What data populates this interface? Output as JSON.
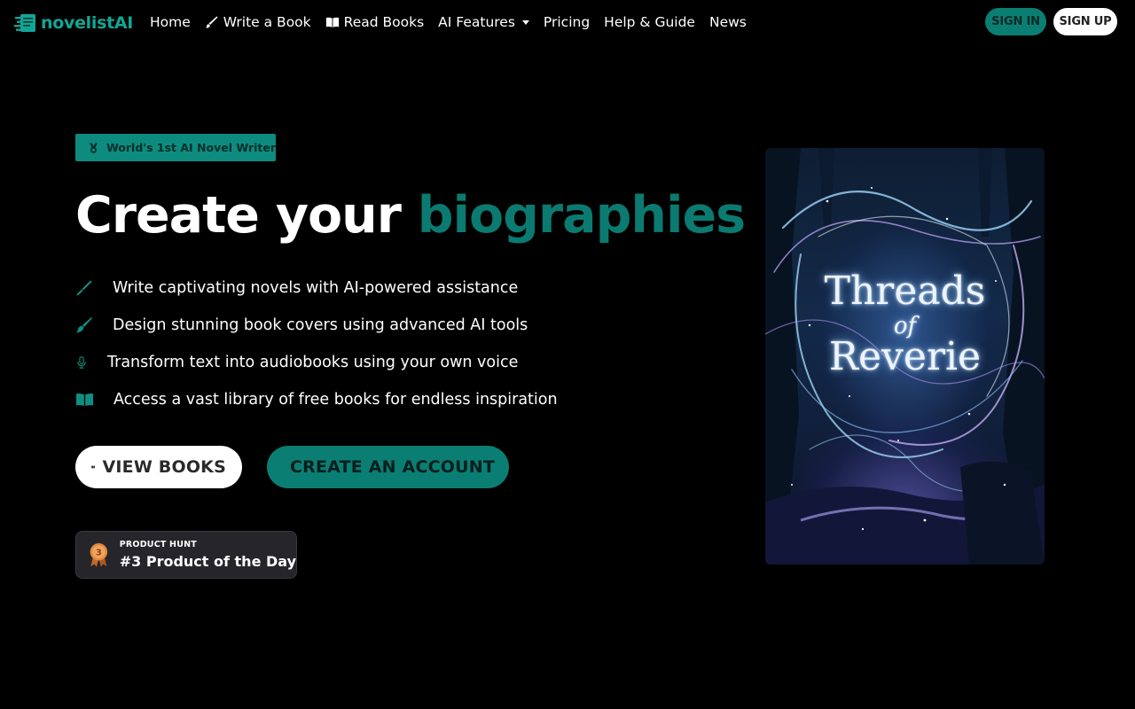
{
  "brand": {
    "name": "novelistAI"
  },
  "nav": {
    "links": [
      {
        "label": "Home",
        "icon": ""
      },
      {
        "label": "Write a Book",
        "icon": "pencil-icon"
      },
      {
        "label": "Read Books",
        "icon": "book-open-icon"
      },
      {
        "label": "AI Features",
        "icon": "chevron-down-icon"
      },
      {
        "label": "Pricing",
        "icon": ""
      },
      {
        "label": "Help & Guide",
        "icon": ""
      },
      {
        "label": "News",
        "icon": ""
      }
    ],
    "sign_in": "SIGN IN",
    "sign_up": "SIGN UP"
  },
  "hero": {
    "badge": "World's 1st AI Novel Writer",
    "headline_prefix": "Create your",
    "headline_accent": "biographies",
    "features": [
      {
        "icon": "pen-nib-icon",
        "text": "Write captivating novels with AI-powered assistance"
      },
      {
        "icon": "paintbrush-icon",
        "text": "Design stunning book covers using advanced AI tools"
      },
      {
        "icon": "microphone-icon",
        "text": "Transform text into audiobooks using your own voice"
      },
      {
        "icon": "book-open-icon",
        "text": "Access a vast library of free books for endless inspiration"
      }
    ],
    "view_books": "VIEW BOOKS",
    "create_account": "CREATE AN ACCOUNT"
  },
  "product_hunt": {
    "rank": "3",
    "label_small": "PRODUCT HUNT",
    "label_big": "#3 Product of the Day"
  },
  "book_cover": {
    "title_line1": "Threads",
    "title_line2": "of",
    "title_line3": "Reverie"
  },
  "colors": {
    "accent": "#0b7a70",
    "brand": "#12a594",
    "background": "#000000"
  }
}
